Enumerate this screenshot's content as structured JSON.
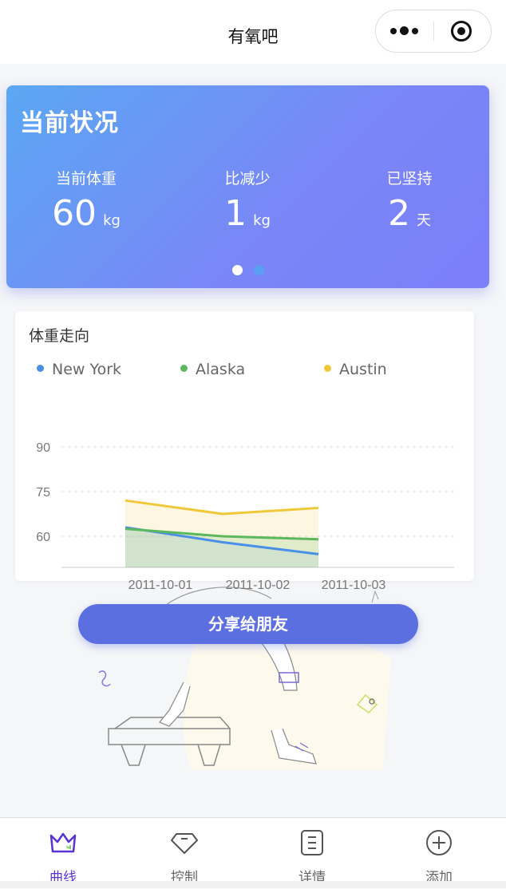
{
  "navbar": {
    "title": "有氧吧",
    "more_icon": "more-dots-icon",
    "close_icon": "close-circle-icon"
  },
  "status": {
    "title": "当前状况",
    "stats": [
      {
        "label": "当前体重",
        "value": "60",
        "unit": "kg"
      },
      {
        "label": "比减少",
        "value": "1",
        "unit": "kg"
      },
      {
        "label": "已坚持",
        "value": "2",
        "unit": "天"
      }
    ],
    "carousel": {
      "pages": 2,
      "active_index": 0
    }
  },
  "chart": {
    "title": "体重走向",
    "legend": [
      {
        "name": "New York",
        "color": "#4a8fe7"
      },
      {
        "name": "Alaska",
        "color": "#5cb85c"
      },
      {
        "name": "Austin",
        "color": "#f0c93a"
      }
    ]
  },
  "chart_data": {
    "type": "area",
    "title": "体重走向",
    "categories": [
      "2011-10-01",
      "2011-10-02",
      "2011-10-03"
    ],
    "y_ticks": [
      60,
      75,
      90
    ],
    "ylim": [
      50,
      95
    ],
    "grid": true,
    "legend_position": "top",
    "series": [
      {
        "name": "New York",
        "values": [
          63,
          58,
          54
        ],
        "color": "#4a8fe7"
      },
      {
        "name": "Alaska",
        "values": [
          62.5,
          60,
          59
        ],
        "color": "#5cb85c"
      },
      {
        "name": "Austin",
        "values": [
          72,
          67.5,
          69.5
        ],
        "color": "#f0c93a"
      }
    ]
  },
  "share_button": {
    "label": "分享给朋友"
  },
  "tabbar": {
    "items": [
      {
        "label": "曲线",
        "icon": "crown-icon",
        "active": true
      },
      {
        "label": "控制",
        "icon": "diamond-icon",
        "active": false
      },
      {
        "label": "详情",
        "icon": "document-icon",
        "active": false
      },
      {
        "label": "添加",
        "icon": "plus-circle-icon",
        "active": false
      }
    ]
  }
}
